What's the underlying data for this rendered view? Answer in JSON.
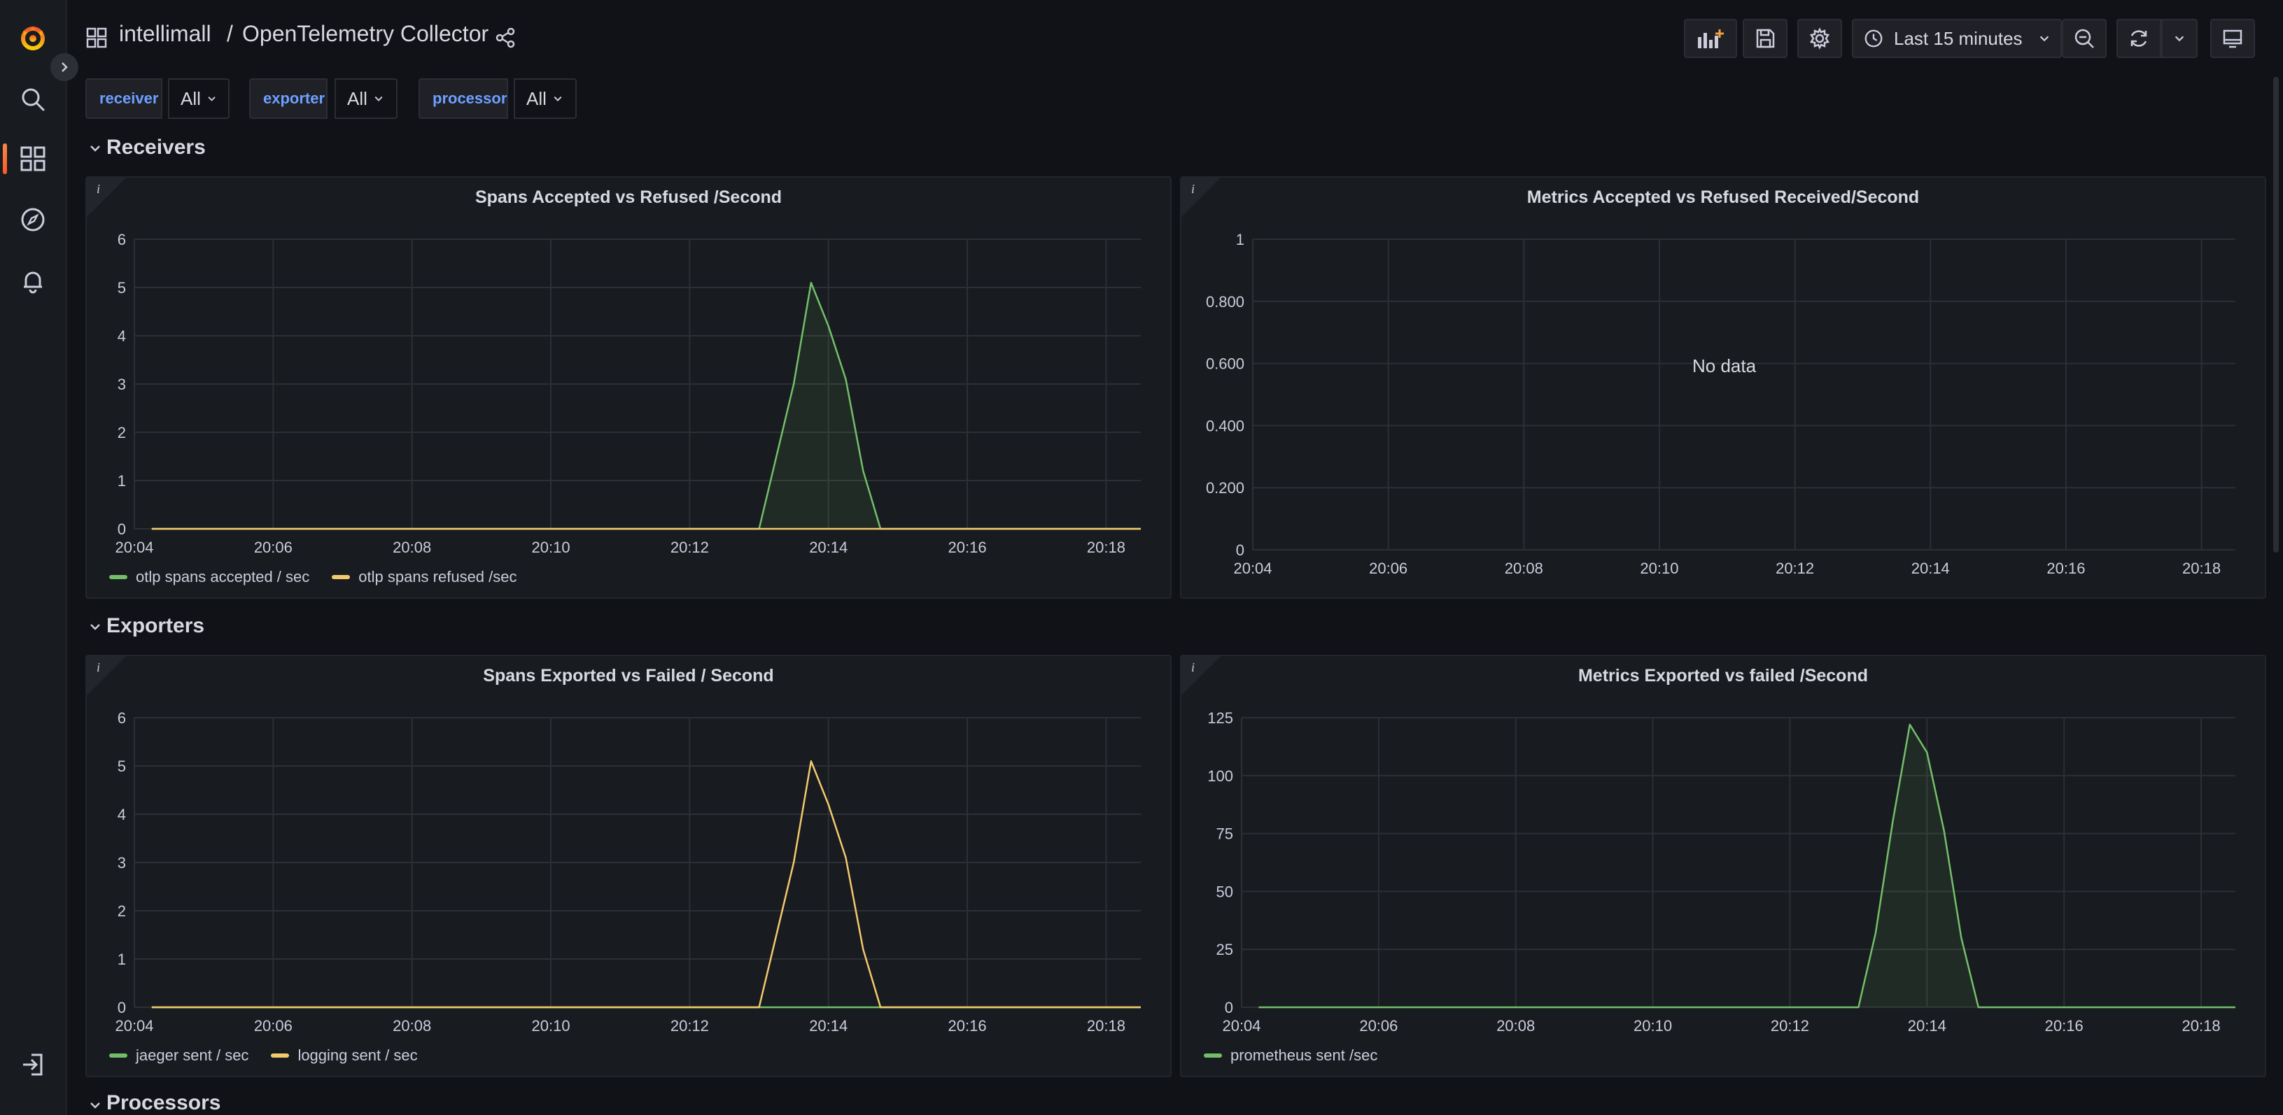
{
  "breadcrumb": {
    "folder": "intellimall",
    "separator": "/",
    "dashboard": "OpenTelemetry Collector"
  },
  "toolbar": {
    "time_range": "Last 15 minutes"
  },
  "variables": [
    {
      "label": "receiver",
      "value": "All"
    },
    {
      "label": "exporter",
      "value": "All"
    },
    {
      "label": "processor",
      "value": "All"
    }
  ],
  "rows": [
    {
      "title": "Receivers"
    },
    {
      "title": "Exporters"
    },
    {
      "title": "Processors"
    }
  ],
  "colors": {
    "green": "#73bf69",
    "yellow": "#fade2a",
    "orange": "#f2b03e",
    "accent": "#f56d2c",
    "link": "#6e9fff"
  },
  "panels": [
    {
      "title": "Spans Accepted vs Refused /Second",
      "no_data": "",
      "legend": [
        {
          "name": "otlp spans accepted / sec",
          "color": "#73bf69"
        },
        {
          "name": "otlp spans refused /sec",
          "color": "#f2c96d"
        }
      ]
    },
    {
      "title": "Metrics Accepted vs Refused Received/Second",
      "no_data": "No data",
      "legend": []
    },
    {
      "title": "Spans Exported vs Failed / Second",
      "no_data": "",
      "legend": [
        {
          "name": "jaeger sent / sec",
          "color": "#73bf69"
        },
        {
          "name": "logging sent / sec",
          "color": "#f2c96d"
        }
      ]
    },
    {
      "title": "Metrics Exported vs failed /Second",
      "no_data": "",
      "legend": [
        {
          "name": "prometheus sent /sec",
          "color": "#73bf69"
        }
      ]
    }
  ],
  "chart_data": [
    {
      "type": "line",
      "title": "Spans Accepted vs Refused /Second",
      "x_ticks": [
        "20:04",
        "20:06",
        "20:08",
        "20:10",
        "20:12",
        "20:14",
        "20:16",
        "20:18"
      ],
      "y_ticks": [
        "0",
        "1",
        "2",
        "3",
        "4",
        "5",
        "6"
      ],
      "ylim": [
        0,
        6
      ],
      "xlim": [
        "20:04",
        "20:18:30"
      ],
      "grid": true,
      "legend_position": "bottom-left",
      "series": [
        {
          "name": "otlp spans accepted / sec",
          "color": "#73bf69",
          "fill": true,
          "x": [
            "20:04:15",
            "20:13:00",
            "20:13:30",
            "20:13:45",
            "20:14:00",
            "20:14:15",
            "20:14:30",
            "20:14:45",
            "20:18:30"
          ],
          "y": [
            0,
            0,
            3.0,
            5.1,
            4.2,
            3.1,
            1.2,
            0,
            0
          ]
        },
        {
          "name": "otlp spans refused /sec",
          "color": "#f2c96d",
          "fill": false,
          "x": [
            "20:04:15",
            "20:18:30"
          ],
          "y": [
            0,
            0
          ]
        }
      ]
    },
    {
      "type": "line",
      "title": "Metrics Accepted vs Refused Received/Second",
      "x_ticks": [
        "20:04",
        "20:06",
        "20:08",
        "20:10",
        "20:12",
        "20:14",
        "20:16",
        "20:18"
      ],
      "y_ticks": [
        "0",
        "0.200",
        "0.400",
        "0.600",
        "0.800",
        "1"
      ],
      "ylim": [
        0,
        1
      ],
      "xlim": [
        "20:04",
        "20:18:30"
      ],
      "grid": true,
      "series": []
    },
    {
      "type": "line",
      "title": "Spans Exported vs Failed / Second",
      "x_ticks": [
        "20:04",
        "20:06",
        "20:08",
        "20:10",
        "20:12",
        "20:14",
        "20:16",
        "20:18"
      ],
      "y_ticks": [
        "0",
        "1",
        "2",
        "3",
        "4",
        "5",
        "6"
      ],
      "ylim": [
        0,
        6
      ],
      "xlim": [
        "20:04",
        "20:18:30"
      ],
      "grid": true,
      "legend_position": "bottom-left",
      "series": [
        {
          "name": "jaeger sent / sec",
          "color": "#73bf69",
          "fill": false,
          "x": [
            "20:04:15",
            "20:18:30"
          ],
          "y": [
            0,
            0
          ]
        },
        {
          "name": "logging sent / sec",
          "color": "#f2c96d",
          "fill": false,
          "x": [
            "20:04:15",
            "20:13:00",
            "20:13:30",
            "20:13:45",
            "20:14:00",
            "20:14:15",
            "20:14:30",
            "20:14:45",
            "20:18:30"
          ],
          "y": [
            0,
            0,
            3.0,
            5.1,
            4.2,
            3.1,
            1.2,
            0,
            0
          ]
        }
      ]
    },
    {
      "type": "line",
      "title": "Metrics Exported vs failed /Second",
      "x_ticks": [
        "20:04",
        "20:06",
        "20:08",
        "20:10",
        "20:12",
        "20:14",
        "20:16",
        "20:18"
      ],
      "y_ticks": [
        "0",
        "25",
        "50",
        "75",
        "100",
        "125"
      ],
      "ylim": [
        0,
        125
      ],
      "xlim": [
        "20:04",
        "20:18:30"
      ],
      "grid": true,
      "legend_position": "bottom-left",
      "series": [
        {
          "name": "prometheus sent /sec",
          "color": "#73bf69",
          "fill": true,
          "x": [
            "20:04:15",
            "20:13:00",
            "20:13:15",
            "20:13:30",
            "20:13:45",
            "20:14:00",
            "20:14:15",
            "20:14:30",
            "20:14:45",
            "20:18:30"
          ],
          "y": [
            0,
            0,
            32,
            80,
            122,
            110,
            76,
            30,
            0,
            0
          ]
        }
      ]
    }
  ]
}
